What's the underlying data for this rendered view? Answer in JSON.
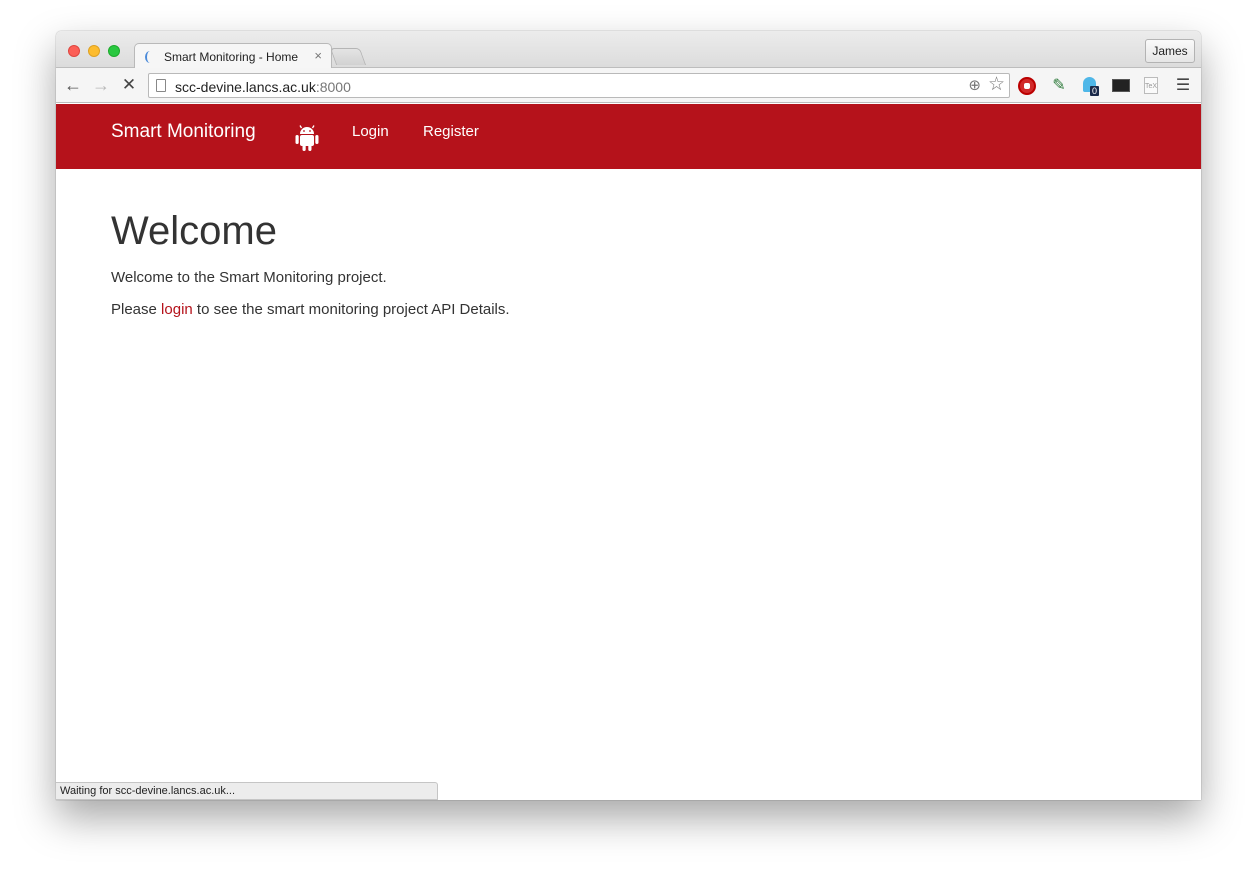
{
  "browser": {
    "tab_title": "Smart Monitoring - Home",
    "tab_close": "×",
    "profile_name": "James",
    "url_host": "scc-devine.lancs.ac.uk",
    "url_port": ":8000",
    "status_text": "Waiting for scc-devine.lancs.ac.uk...",
    "ghostery_badge": "0",
    "tex_label": "TeX",
    "back_glyph": "←",
    "forward_glyph": "→",
    "stop_glyph": "✕",
    "zoom_glyph": "⊕",
    "star_glyph": "☆",
    "eyedropper_glyph": "✎",
    "menu_glyph": "☰"
  },
  "navbar": {
    "brand": "Smart Monitoring",
    "links": [
      {
        "label": "Login"
      },
      {
        "label": "Register"
      }
    ],
    "color": "#b5121b"
  },
  "main": {
    "heading": "Welcome",
    "intro": "Welcome to the Smart Monitoring project.",
    "login_prefix": "Please ",
    "login_link": "login",
    "login_suffix": " to see the smart monitoring project API Details."
  }
}
